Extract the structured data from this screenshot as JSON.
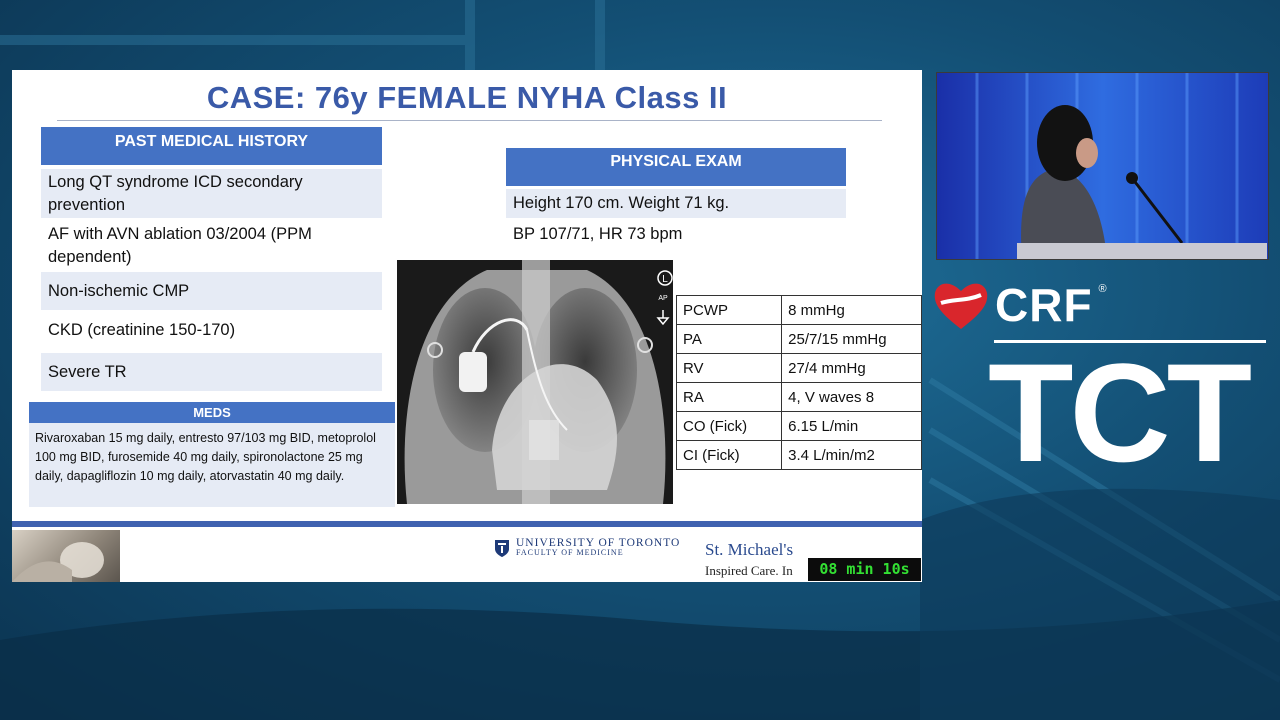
{
  "slide": {
    "title": "CASE: 76y FEMALE NYHA Class II",
    "past_medical_history": {
      "header": "PAST MEDICAL HISTORY",
      "items": [
        "Long QT syndrome ICD secondary prevention",
        "AF with AVN ablation 03/2004 (PPM dependent)",
        "Non-ischemic CMP",
        "CKD (creatinine 150-170)",
        "Severe TR"
      ]
    },
    "meds": {
      "header": "MEDS",
      "text": "Rivaroxaban 15 mg daily, entresto 97/103 mg BID, metoprolol 100 mg BID, furosemide 40 mg daily, spironolactone 25 mg daily, dapagliflozin 10 mg daily, atorvastatin 40 mg daily."
    },
    "physical_exam": {
      "header": "PHYSICAL EXAM",
      "items": [
        "Height 170 cm. Weight 71 kg.",
        "BP 107/71, HR 73 bpm"
      ]
    },
    "xray_markers": {
      "left": "L",
      "ap": "AP"
    },
    "hemodynamics": [
      {
        "label": "PCWP",
        "value": "8 mmHg"
      },
      {
        "label": "PA",
        "value": "25/7/15 mmHg"
      },
      {
        "label": "RV",
        "value": "27/4 mmHg"
      },
      {
        "label": "RA",
        "value": "4, V waves 8"
      },
      {
        "label": "CO (Fick)",
        "value": "6.15 L/min"
      },
      {
        "label": "CI (Fick)",
        "value": "3.4 L/min/m2"
      }
    ],
    "footer": {
      "uoft_line1": "UNIVERSITY OF TORONTO",
      "uoft_line2": "FACULTY OF MEDICINE",
      "smh_line1": "St. Michael's",
      "smh_line2": "Inspired Care. In"
    }
  },
  "timer": "08 min 10s",
  "branding": {
    "crf": "CRF",
    "registered": "®",
    "tct": "TCT"
  },
  "colors": {
    "accent": "#4472c4",
    "title": "#3a5aa8",
    "band": "#e6ebf5",
    "timer_text": "#33e033",
    "brand_red": "#d9262c"
  }
}
